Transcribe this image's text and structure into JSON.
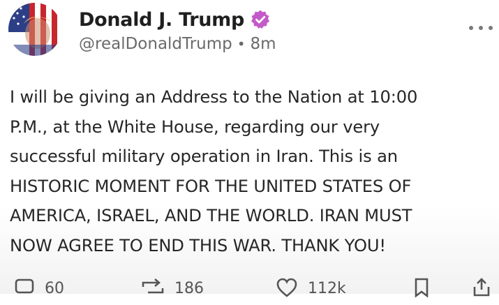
{
  "post": {
    "author": {
      "display_name": "Donald J. Trump",
      "handle": "@realDonaldTrump",
      "separator": "•",
      "time_ago": "8m",
      "verified_icon": "verified-badge-icon",
      "avatar_icon": "profile-avatar"
    },
    "more_icon": "more-options-icon",
    "text_lines": [
      "I will be giving an Address to the Nation at 10:00",
      "P.M., at the White House, regarding our very",
      "successful military operation in Iran. This is an",
      "HISTORIC MOMENT FOR THE UNITED STATES OF",
      "AMERICA, ISRAEL, AND THE WORLD. IRAN MUST",
      "NOW AGREE TO END THIS WAR. THANK YOU!"
    ],
    "actions": {
      "reply": {
        "icon": "reply-icon",
        "count": "60"
      },
      "repost": {
        "icon": "repost-icon",
        "count": "186"
      },
      "like": {
        "icon": "heart-icon",
        "count": "112k"
      },
      "bookmark": {
        "icon": "bookmark-icon"
      },
      "share": {
        "icon": "share-icon"
      }
    },
    "colors": {
      "verified": "#c45ac9",
      "text": "#262626",
      "muted": "#6a6a6a"
    }
  }
}
